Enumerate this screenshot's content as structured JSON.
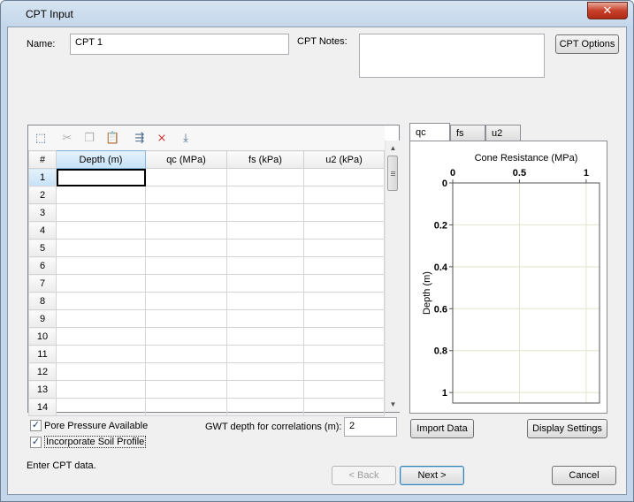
{
  "window": {
    "title": "CPT Input",
    "close_glyph": "✕"
  },
  "form": {
    "name_label": "Name:",
    "name_value": "CPT 1",
    "notes_label": "CPT Notes:",
    "notes_value": "",
    "options_button": "CPT Options"
  },
  "toolbar": {
    "icons": [
      "select-all-icon",
      "cut-icon",
      "copy-icon",
      "paste-icon",
      "insert-row-icon",
      "delete-row-icon",
      "fill-down-icon"
    ]
  },
  "grid": {
    "columns": [
      "#",
      "Depth (m)",
      "qc (MPa)",
      "fs (kPa)",
      "u2 (kPa)"
    ],
    "rows": [
      "1",
      "2",
      "3",
      "4",
      "5",
      "6",
      "7",
      "8",
      "9",
      "10",
      "11",
      "12",
      "13",
      "14"
    ],
    "selected_row": "1",
    "selected_column": "Depth (m)"
  },
  "options": {
    "pore_pressure_label": "Pore Pressure Available",
    "pore_pressure_checked": true,
    "soil_profile_label": "Incorporate Soil Profile",
    "soil_profile_checked": true,
    "gwt_label": "GWT depth for correlations (m):",
    "gwt_value": "2"
  },
  "chart_tabs": [
    "qc",
    "fs",
    "u2"
  ],
  "chart_data": {
    "type": "line",
    "title": "Cone Resistance (MPa)",
    "xlabel": "Cone Resistance (MPa)",
    "ylabel": "Depth (m)",
    "xlim": [
      0,
      1.1
    ],
    "ylim": [
      0,
      1.05
    ],
    "x_ticks": [
      "0",
      "0.5",
      "1"
    ],
    "y_ticks": [
      "0",
      "0.2",
      "0.4",
      "0.6",
      "0.8",
      "1"
    ],
    "x_axis_position": "top",
    "y_inverted": true,
    "grid": true,
    "series": []
  },
  "chart_buttons": {
    "import": "Import Data",
    "display": "Display Settings"
  },
  "status_text": "Enter CPT data.",
  "nav": {
    "back": "< Back",
    "next": "Next >",
    "cancel": "Cancel"
  }
}
